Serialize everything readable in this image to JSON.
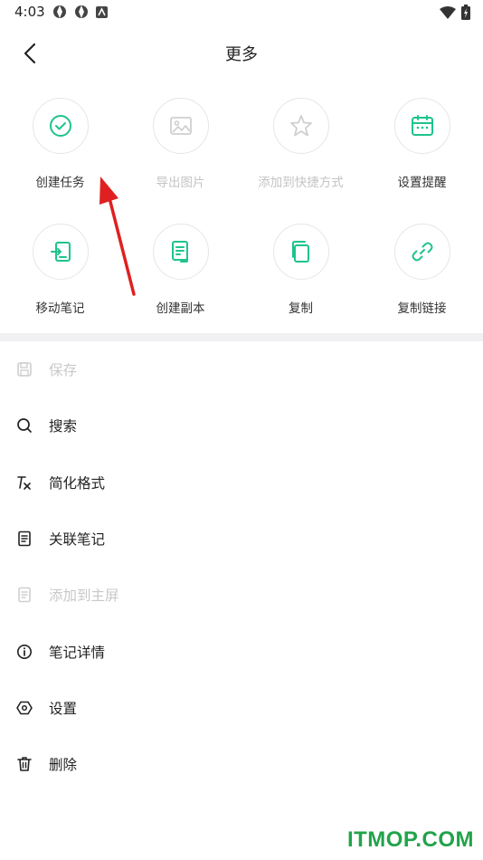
{
  "status_bar": {
    "time": "4:03"
  },
  "header": {
    "title": "更多"
  },
  "grid": {
    "rows": [
      [
        {
          "label": "创建任务",
          "icon": "check-circle-icon",
          "enabled": true
        },
        {
          "label": "导出图片",
          "icon": "image-icon",
          "enabled": false
        },
        {
          "label": "添加到快捷方式",
          "icon": "star-icon",
          "enabled": false
        },
        {
          "label": "设置提醒",
          "icon": "calendar-icon",
          "enabled": true
        }
      ],
      [
        {
          "label": "移动笔记",
          "icon": "move-note-icon",
          "enabled": true
        },
        {
          "label": "创建副本",
          "icon": "duplicate-note-icon",
          "enabled": true
        },
        {
          "label": "复制",
          "icon": "copy-icon",
          "enabled": true
        },
        {
          "label": "复制链接",
          "icon": "link-icon",
          "enabled": true
        }
      ]
    ]
  },
  "menu": {
    "items": [
      {
        "label": "保存",
        "icon": "save-icon",
        "enabled": false
      },
      {
        "label": "搜索",
        "icon": "search-icon",
        "enabled": true
      },
      {
        "label": "简化格式",
        "icon": "clear-format-icon",
        "enabled": true
      },
      {
        "label": "关联笔记",
        "icon": "linked-note-icon",
        "enabled": true
      },
      {
        "label": "添加到主屏",
        "icon": "home-screen-icon",
        "enabled": false
      },
      {
        "label": "笔记详情",
        "icon": "info-icon",
        "enabled": true
      },
      {
        "label": "设置",
        "icon": "settings-icon",
        "enabled": true
      },
      {
        "label": "删除",
        "icon": "trash-icon",
        "enabled": true
      }
    ]
  },
  "colors": {
    "accent": "#1ec48a",
    "disabled": "#c8c8c8",
    "annotation": "#e02020",
    "watermark": "#22a34a"
  },
  "watermark": "ITMOP.COM"
}
